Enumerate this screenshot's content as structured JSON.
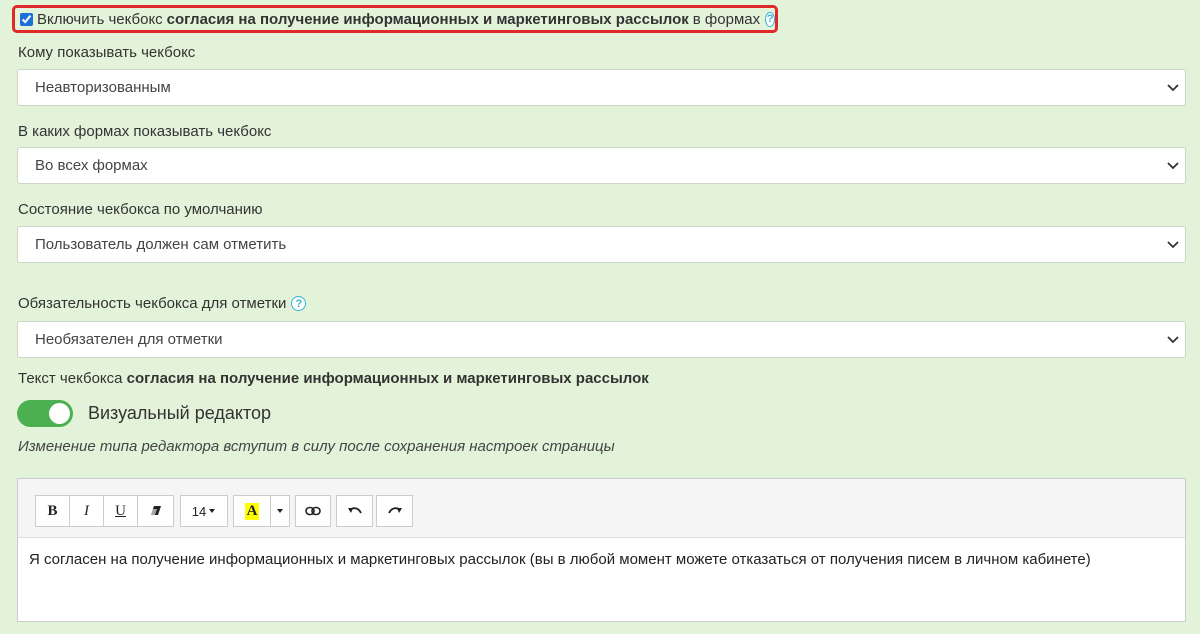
{
  "enable_checkbox": {
    "checked": true,
    "prefix": "Включить чекбокс",
    "bold": "согласия на получение информационных и маркетинговых рассылок",
    "suffix": "в формах",
    "help": "?"
  },
  "fields": [
    {
      "label": "Кому показывать чекбокс",
      "value": "Неавторизованным"
    },
    {
      "label": "В каких формах показывать чекбокс",
      "value": "Во всех формах"
    },
    {
      "label": "Состояние чекбокса по умолчанию",
      "value": "Пользователь должен сам отметить"
    },
    {
      "label": "Обязательность чекбокса для отметки",
      "value": "Необязателен для отметки",
      "help": "?"
    }
  ],
  "checkbox_text": {
    "prefix": "Текст чекбокса",
    "bold": "согласия на получение информационных и маркетинговых рассылок"
  },
  "toggle": {
    "label": "Визуальный редактор",
    "on": true
  },
  "note": "Изменение типа редактора вступит в силу после сохранения настроек страницы",
  "editor": {
    "toolbar": {
      "bold": "B",
      "italic": "I",
      "underline": "U",
      "font_size": "14",
      "highlight": "A",
      "highlight_color": "#ffff00"
    },
    "content": "Я согласен на получение информационных и маркетинговых рассылок (вы в любой момент можете отказаться от получения писем в личном кабинете)"
  }
}
